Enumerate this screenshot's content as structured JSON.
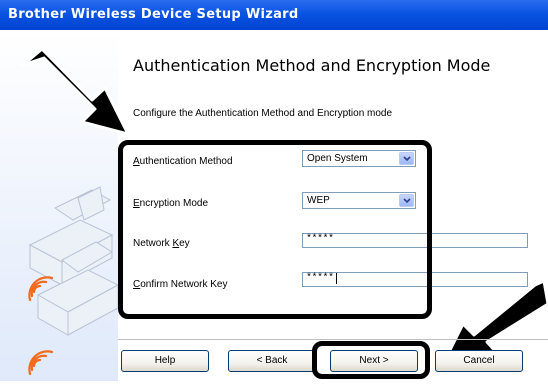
{
  "window": {
    "title": "Brother Wireless Device Setup Wizard"
  },
  "page": {
    "heading": "Authentication Method and Encryption Mode",
    "subtitle": "Configure the Authentication Method and Encryption mode"
  },
  "form": {
    "auth_method": {
      "label": "Authentication Method",
      "value": "Open System"
    },
    "encryption_mode": {
      "label": "Encryption Mode",
      "value": "WEP"
    },
    "network_key": {
      "label": "Network Key",
      "value": "*****"
    },
    "confirm_key": {
      "label": "Confirm Network Key",
      "value": "*****"
    }
  },
  "buttons": {
    "help": "Help",
    "back": "< Back",
    "next": "Next >",
    "cancel": "Cancel"
  },
  "colors": {
    "titlebar": "#0a54e2",
    "annotation": "#000000",
    "signal": "#f26a1c"
  },
  "icons": [
    "arrow-pointer-left",
    "arrow-pointer-right",
    "printer-illustration",
    "wireless-signal-icon",
    "chevron-down-icon"
  ]
}
